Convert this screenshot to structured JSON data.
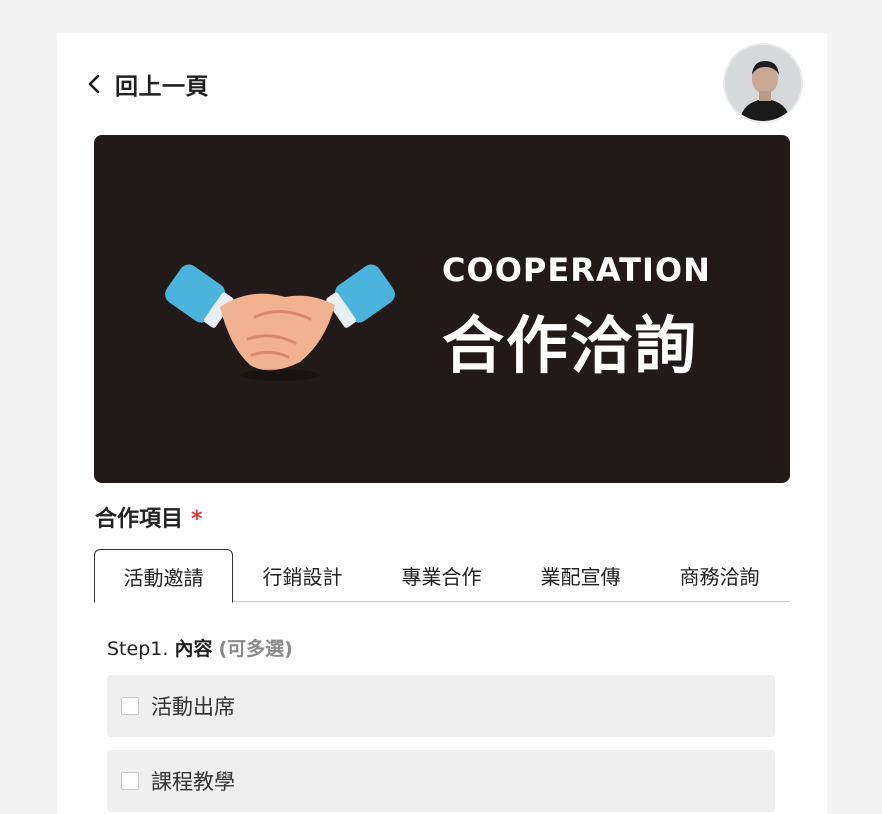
{
  "header": {
    "back_label": "回上一頁"
  },
  "banner": {
    "title": "COOPERATION",
    "subtitle": "合作洽詢"
  },
  "section": {
    "label": "合作項目",
    "required_mark": "*"
  },
  "tabs": [
    {
      "label": "活動邀請",
      "active": true
    },
    {
      "label": "行銷設計",
      "active": false
    },
    {
      "label": "專業合作",
      "active": false
    },
    {
      "label": "業配宣傳",
      "active": false
    },
    {
      "label": "商務洽詢",
      "active": false
    }
  ],
  "step": {
    "prefix": "Step1.",
    "title": "內容",
    "hint": "(可多選)"
  },
  "options": [
    {
      "label": "活動出席",
      "checked": false
    },
    {
      "label": "課程教學",
      "checked": false
    }
  ],
  "colors": {
    "banner_bg": "#211a18",
    "required": "#d63a3a",
    "page_bg": "#f4f4f4"
  }
}
